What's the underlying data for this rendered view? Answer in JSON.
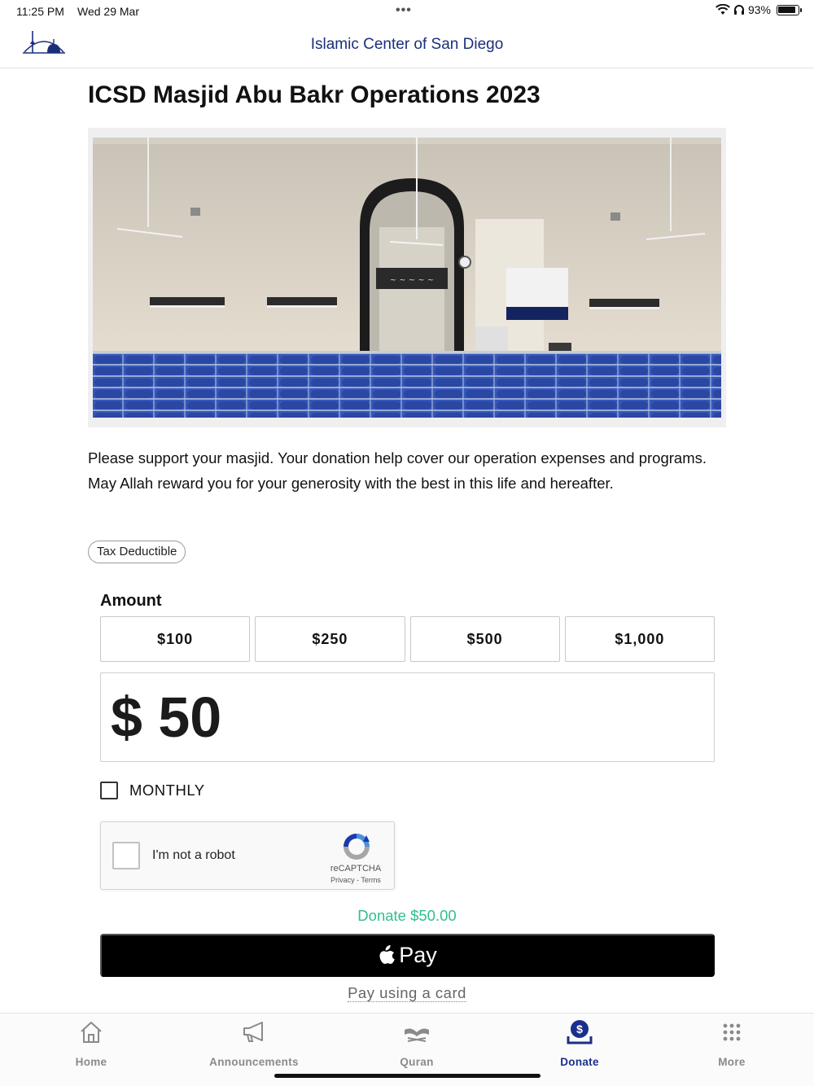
{
  "status": {
    "time": "11:25 PM",
    "date": "Wed 29 Mar",
    "battery": "93%"
  },
  "nav": {
    "title": "Islamic Center of San Diego"
  },
  "page": {
    "title": "ICSD Masjid Abu Bakr Operations 2023",
    "description": "Please support your masjid. Your donation help cover our operation expenses and programs. May Allah reward you for your generosity with the best in this life and hereafter.",
    "tag": "Tax Deductible"
  },
  "donation": {
    "amount_label": "Amount",
    "presets": [
      "$100",
      "$250",
      "$500",
      "$1,000"
    ],
    "amount_value": "$ 50",
    "monthly_label": "MONTHLY",
    "monthly_checked": false,
    "summary": "Donate $50.00",
    "apple_pay_label": "Pay",
    "pay_card_label": "Pay using a card"
  },
  "recaptcha": {
    "label": "I'm not a robot",
    "brand": "reCAPTCHA",
    "links": "Privacy - Terms"
  },
  "tabs": [
    {
      "label": "Home",
      "icon": "home-icon",
      "active": false
    },
    {
      "label": "Announcements",
      "icon": "megaphone-icon",
      "active": false
    },
    {
      "label": "Quran",
      "icon": "book-icon",
      "active": false
    },
    {
      "label": "Donate",
      "icon": "donate-icon",
      "active": true
    },
    {
      "label": "More",
      "icon": "grid-icon",
      "active": false
    }
  ],
  "colors": {
    "brand_blue": "#1a2f7a",
    "active_tab": "#1a2f8a",
    "donate_green": "#2fbf8f",
    "apple_pay_bg": "#000000"
  }
}
